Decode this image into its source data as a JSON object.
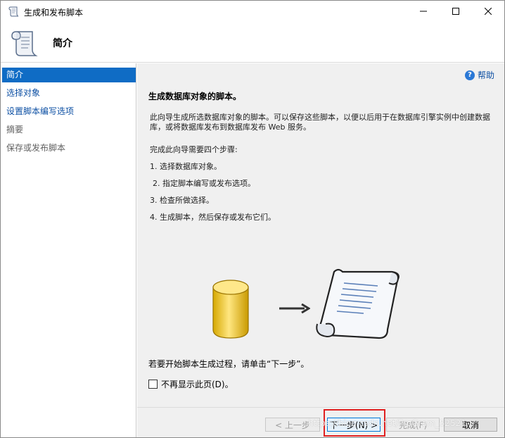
{
  "window": {
    "title": "生成和发布脚本",
    "icon": "script-scroll-icon"
  },
  "header": {
    "title": "简介",
    "icon": "script-scroll-icon"
  },
  "nav": {
    "items": [
      {
        "label": "简介",
        "state": "active"
      },
      {
        "label": "选择对象",
        "state": "link"
      },
      {
        "label": "设置脚本编写选项",
        "state": "link"
      },
      {
        "label": "摘要",
        "state": "disabled"
      },
      {
        "label": "保存或发布脚本",
        "state": "disabled"
      }
    ]
  },
  "content": {
    "help_label": "帮助",
    "heading": "生成数据库对象的脚本。",
    "description": "此向导生成所选数据库对象的脚本。可以保存这些脚本，以便以后用于在数据库引擎实例中创建数据库，或将数据库发布到数据库发布 Web 服务。",
    "steps_intro": "完成此向导需要四个步骤:",
    "steps": [
      "1. 选择数据库对象。",
      "2. 指定脚本编写或发布选项。",
      "3. 检查所做选择。",
      "4. 生成脚本，然后保存或发布它们。"
    ],
    "start_text": "若要开始脚本生成过程，请单击“下一步”。",
    "checkbox_label": "不再显示此页(D)。"
  },
  "footer": {
    "prev_label": "< 上一步",
    "next_label": "下一步(N) >",
    "finish_label": "完成(F)",
    "cancel_label": "取消"
  },
  "watermark": "https://blog.csdn.net/ProGram_52521",
  "colors": {
    "nav_active_bg": "#0f6cc5",
    "link": "#0c4fa3",
    "highlight_box": "#e02020"
  }
}
